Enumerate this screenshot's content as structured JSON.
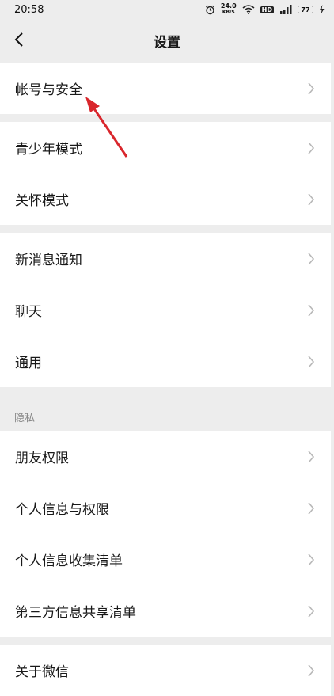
{
  "status_bar": {
    "time": "20:58",
    "net_speed_value": "24.0",
    "net_speed_unit": "KB/S",
    "hd_badge": "HD",
    "battery": "77"
  },
  "header": {
    "title": "设置"
  },
  "groups": [
    {
      "items": [
        {
          "label": "帐号与安全"
        }
      ]
    },
    {
      "items": [
        {
          "label": "青少年模式"
        },
        {
          "label": "关怀模式"
        }
      ]
    },
    {
      "items": [
        {
          "label": "新消息通知"
        },
        {
          "label": "聊天"
        },
        {
          "label": "通用"
        }
      ]
    },
    {
      "section_label": "隐私",
      "items": [
        {
          "label": "朋友权限"
        },
        {
          "label": "个人信息与权限"
        },
        {
          "label": "个人信息收集清单"
        },
        {
          "label": "第三方信息共享清单"
        }
      ]
    },
    {
      "items": [
        {
          "label": "关于微信"
        }
      ]
    }
  ],
  "annotation": {
    "arrow_color": "#d9262c"
  }
}
